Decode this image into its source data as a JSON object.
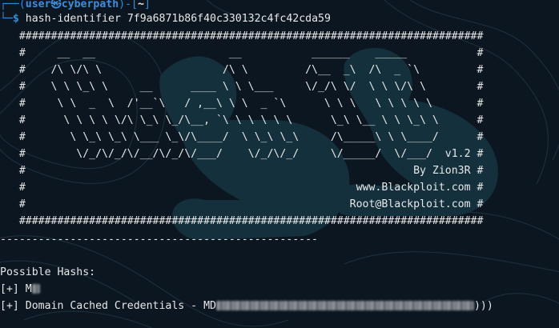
{
  "prompt": {
    "open": "┌──(",
    "user": "user㉿cyberpath",
    "mid": ")-[",
    "path": "~",
    "close": "]",
    "branch": "└─",
    "dollar": "$"
  },
  "command": "hash-identifier 7f9a6871b86f40c330132c4fc42cda59",
  "banner_lines": [
    "   #########################################################################",
    "   #     __  __                     __           ______    _____           #",
    "   #    /\\ \\/\\ \\                   /\\ \\         /\\__  _\\  /\\  _ `\\         #",
    "   #    \\ \\ \\_\\ \\     __      ____ \\ \\ \\___     \\/_/\\ \\/  \\ \\ \\/\\ \\        #",
    "   #     \\ \\  _  \\  /'__`\\   / ,__\\ \\ \\  _ `\\      \\ \\ \\   \\ \\ \\ \\ \\       #",
    "   #      \\ \\ \\ \\ \\/\\ \\_\\ \\_/\\__, `\\ \\ \\ \\ \\ \\      \\_\\ \\__ \\ \\ \\_\\ \\      #",
    "   #       \\ \\_\\ \\_\\ \\___ \\_\\/\\____/  \\ \\_\\ \\_\\     /\\_____\\ \\ \\____/      #",
    "   #        \\/_/\\/_/\\/__/\\/_/\\/___/    \\/_/\\/_/     \\/_____/  \\/___/  v1.2 #",
    "   #                                                             By Zion3R #",
    "   #                                                    www.Blackploit.com #",
    "   #                                                   Root@Blackploit.com #",
    "   #########################################################################"
  ],
  "separator": "--------------------------------------------------",
  "results_header": "Possible Hashs:",
  "results": [
    {
      "prefix": "[+] M",
      "text": ""
    },
    {
      "prefix": "[+] Domain Cached Credentials - MD",
      "text": ")))"
    }
  ],
  "colors": {
    "background": "#0b1620",
    "prompt_blue": "#2f8fd8",
    "text": "#e8e8e8"
  }
}
